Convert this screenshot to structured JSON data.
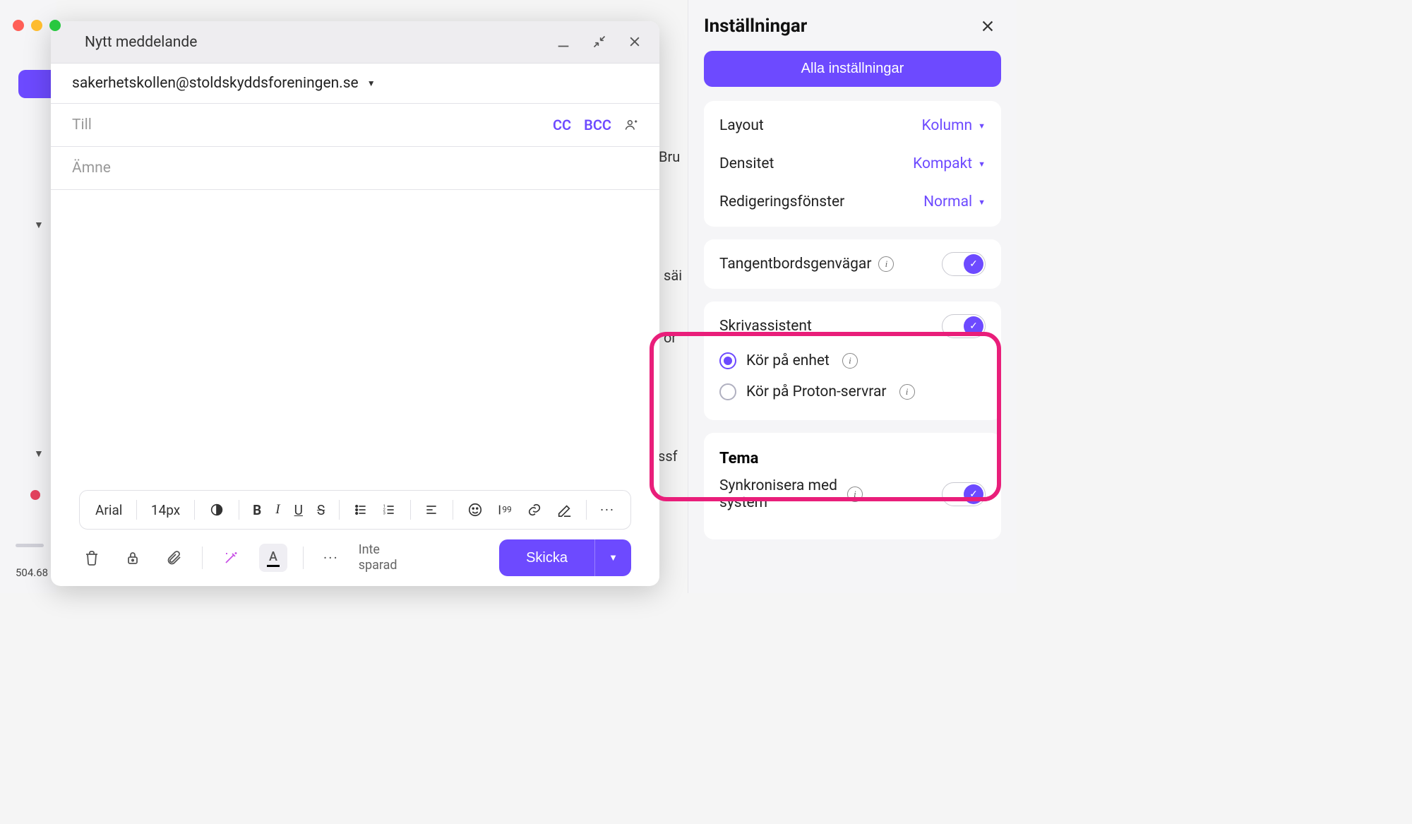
{
  "compose": {
    "title": "Nytt meddelande",
    "from": "sakerhetskollen@stoldskyddsforeningen.se",
    "to_label": "Till",
    "cc": "CC",
    "bcc": "BCC",
    "subject_placeholder": "Ämne",
    "font_name": "Arial",
    "font_size": "14px",
    "save_status_1": "Inte",
    "save_status_2": "sparad",
    "send": "Skicka"
  },
  "settings": {
    "title": "Inställningar",
    "all": "Alla inställningar",
    "layout": {
      "label": "Layout",
      "value": "Kolumn"
    },
    "density": {
      "label": "Densitet",
      "value": "Kompakt"
    },
    "editor_window": {
      "label": "Redigeringsfönster",
      "value": "Normal"
    },
    "shortcuts": {
      "label": "Tangentbordsgenvägar",
      "on": true
    },
    "assistant": {
      "label": "Skrivassistent",
      "on": true,
      "opt1": "Kör på enhet",
      "opt2": "Kör på Proton-servrar",
      "selected": 1
    },
    "theme_heading": "Tema",
    "sync": {
      "label_1": "Synkronisera med",
      "label_2": "system",
      "on": true
    }
  },
  "storage_text": "504.68",
  "bg": {
    "t1": "Bru",
    "t2": "säi",
    "t3": "or",
    "t4": "ssf"
  }
}
